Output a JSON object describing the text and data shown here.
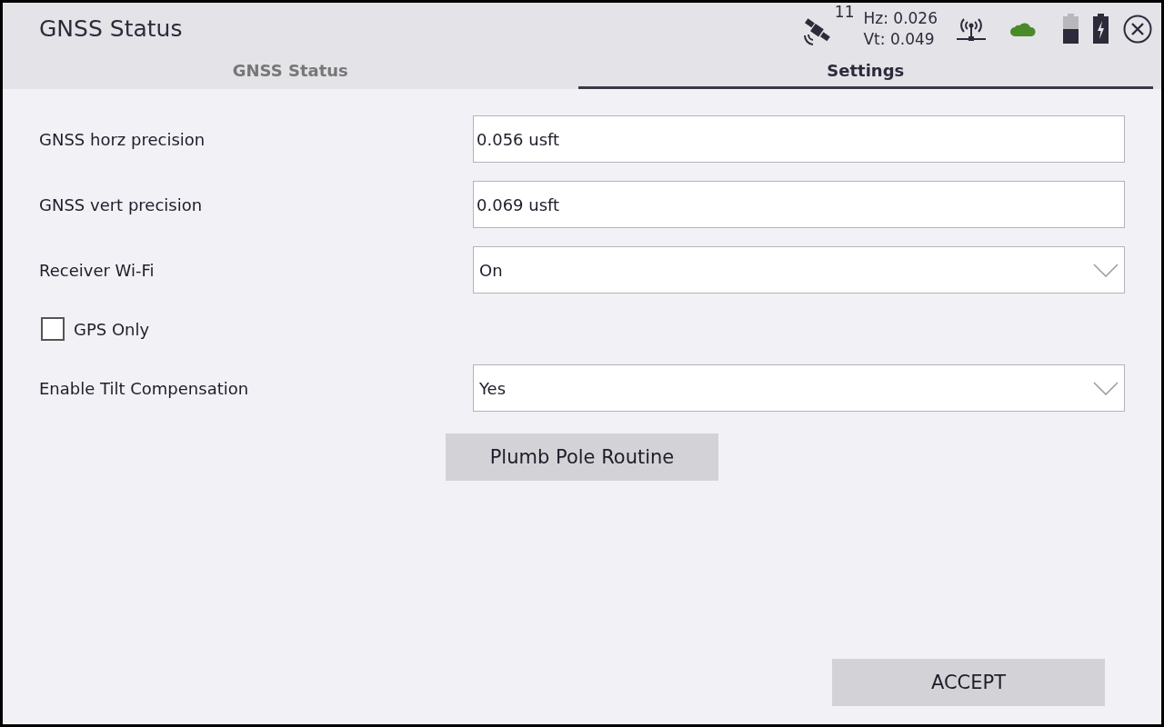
{
  "window": {
    "title": "GNSS Status"
  },
  "status": {
    "satellites": "11",
    "hz": "Hz: 0.026",
    "vt": "Vt: 0.049"
  },
  "tabs": [
    {
      "label": "GNSS Status",
      "selected": false
    },
    {
      "label": "Settings",
      "selected": true
    }
  ],
  "fields": [
    {
      "kind": "text",
      "label": "GNSS horz precision",
      "value": "0.056 usft"
    },
    {
      "kind": "text",
      "label": "GNSS vert precision",
      "value": "0.069 usft"
    },
    {
      "kind": "dropdown",
      "label": "Receiver Wi-Fi",
      "value": "On"
    },
    {
      "kind": "checkbox",
      "label": "GPS Only",
      "checked": false
    },
    {
      "kind": "dropdown",
      "label": "Enable Tilt Compensation",
      "value": "Yes"
    }
  ],
  "plumb_button": "Plumb Pole Routine",
  "accept_button": "ACCEPT"
}
